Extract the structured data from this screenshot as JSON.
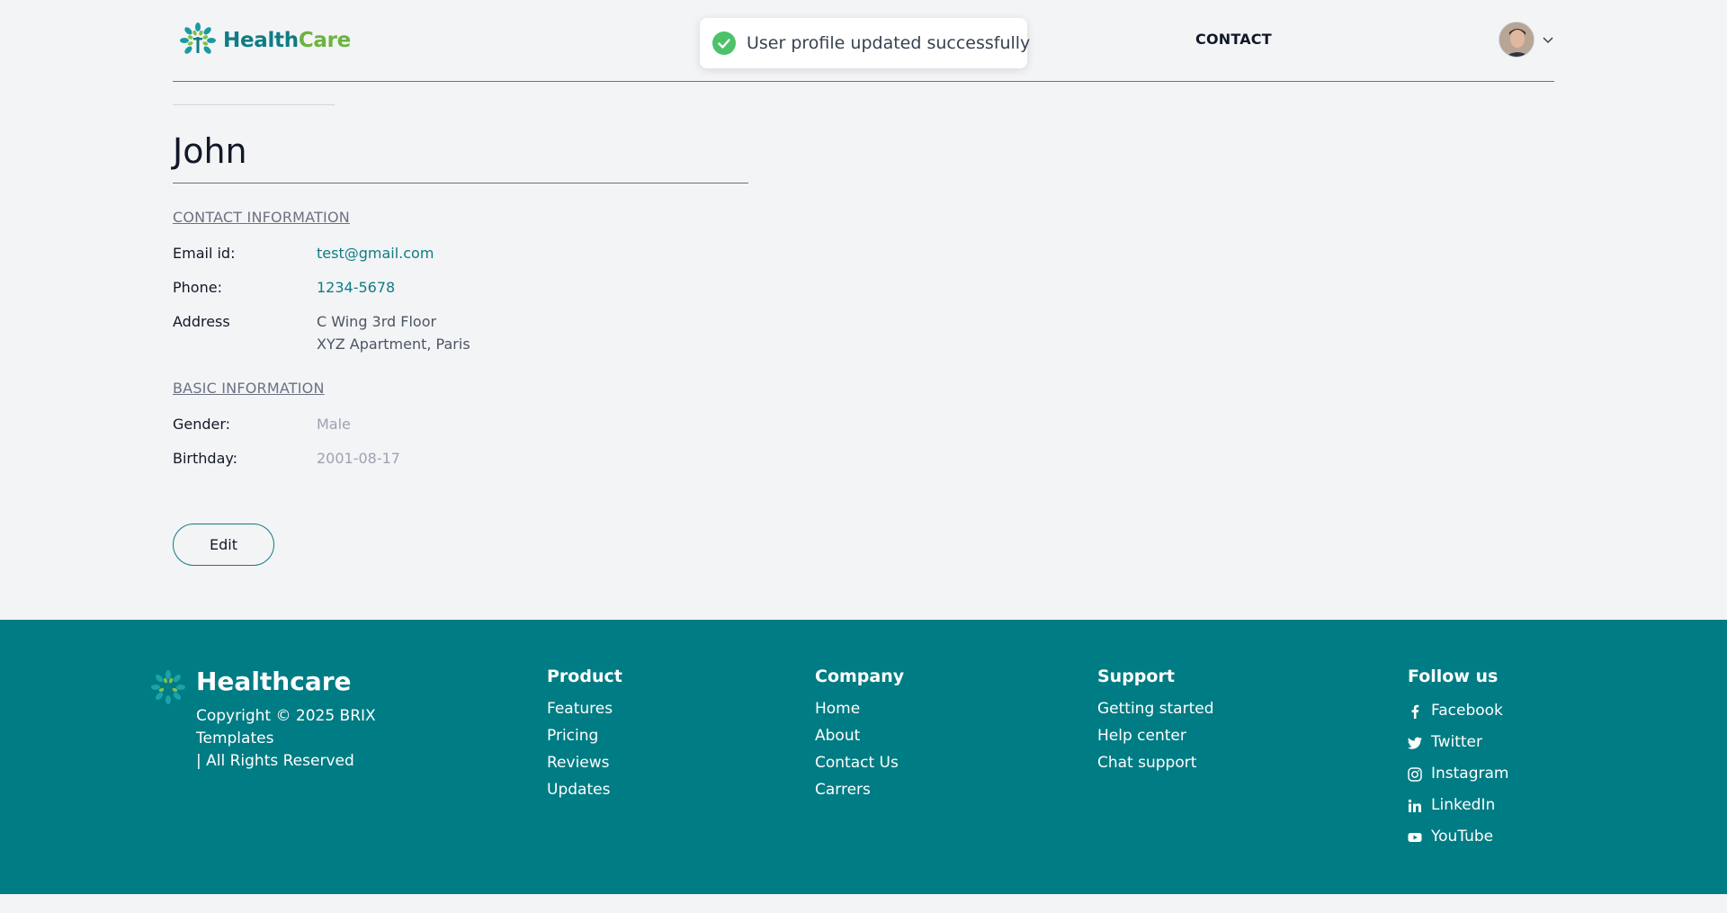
{
  "header": {
    "logo_health": "Health",
    "logo_care": "Care",
    "nav_contact": "CONTACT"
  },
  "toast": {
    "message": "User profile updated successfully",
    "icon": "check-circle-icon",
    "color": "#4cc26a"
  },
  "profile": {
    "name": "John",
    "contact_section": "CONTACT INFORMATION",
    "email_label": "Email id:",
    "email_value": "test@gmail.com",
    "phone_label": "Phone:",
    "phone_value": "1234-5678",
    "address_label": "Address",
    "address_line1": "C Wing 3rd Floor",
    "address_line2": "XYZ Apartment, Paris",
    "basic_section": "BASIC INFORMATION",
    "gender_label": "Gender:",
    "gender_value": "Male",
    "birthday_label": "Birthday:",
    "birthday_value": "2001-08-17",
    "edit_label": "Edit"
  },
  "footer": {
    "brand": "Healthcare",
    "copyright_line1": "Copyright © 2025 BRIX",
    "copyright_line2": "Templates",
    "copyright_line3": "| All Rights Reserved",
    "product": {
      "title": "Product",
      "items": [
        "Features",
        "Pricing",
        "Reviews",
        "Updates"
      ]
    },
    "company": {
      "title": "Company",
      "items": [
        "Home",
        "About",
        "Contact Us",
        "Carrers"
      ]
    },
    "support": {
      "title": "Support",
      "items": [
        "Getting started",
        "Help center",
        "Chat support"
      ]
    },
    "follow": {
      "title": "Follow us",
      "items": [
        {
          "label": "Facebook",
          "icon": "facebook-icon"
        },
        {
          "label": "Twitter",
          "icon": "twitter-icon"
        },
        {
          "label": "Instagram",
          "icon": "instagram-icon"
        },
        {
          "label": "LinkedIn",
          "icon": "linkedin-icon"
        },
        {
          "label": "YouTube",
          "icon": "youtube-icon"
        }
      ]
    }
  },
  "colors": {
    "brand_teal": "#007c84",
    "brand_green": "#6cb33f",
    "page_background": "#f3f4f6"
  }
}
